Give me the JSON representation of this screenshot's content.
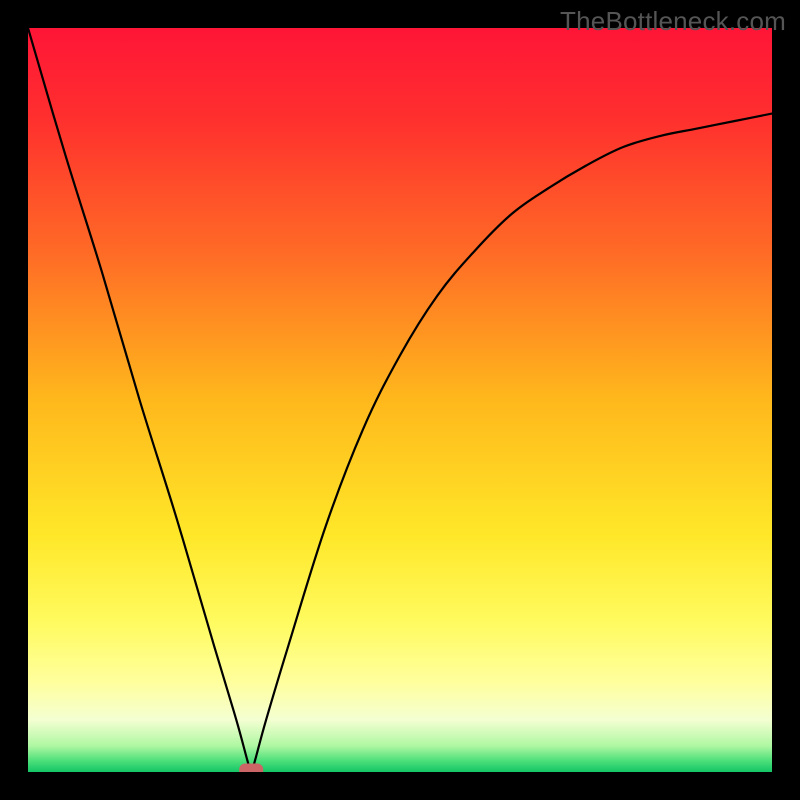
{
  "watermark": "TheBottleneck.com",
  "chart_data": {
    "type": "line",
    "title": "",
    "xlabel": "",
    "ylabel": "",
    "xlim": [
      0,
      1
    ],
    "ylim": [
      0,
      1
    ],
    "minimum_x": 0.3,
    "marker": {
      "x": 0.3,
      "y": 0.0,
      "color": "#cc6666"
    },
    "series": [
      {
        "name": "curve",
        "x": [
          0.0,
          0.05,
          0.1,
          0.15,
          0.2,
          0.25,
          0.28,
          0.295,
          0.3,
          0.305,
          0.32,
          0.35,
          0.4,
          0.45,
          0.5,
          0.55,
          0.6,
          0.65,
          0.7,
          0.75,
          0.8,
          0.85,
          0.9,
          0.95,
          1.0
        ],
        "values": [
          1.0,
          0.83,
          0.67,
          0.5,
          0.34,
          0.17,
          0.07,
          0.015,
          0.0,
          0.015,
          0.07,
          0.17,
          0.33,
          0.46,
          0.56,
          0.64,
          0.7,
          0.75,
          0.785,
          0.815,
          0.84,
          0.855,
          0.865,
          0.875,
          0.885
        ]
      }
    ],
    "gradient_stops": [
      {
        "offset": 0.0,
        "color": "#ff1537"
      },
      {
        "offset": 0.12,
        "color": "#ff2f2e"
      },
      {
        "offset": 0.3,
        "color": "#ff6a26"
      },
      {
        "offset": 0.5,
        "color": "#ffb81c"
      },
      {
        "offset": 0.68,
        "color": "#ffe728"
      },
      {
        "offset": 0.8,
        "color": "#fffb60"
      },
      {
        "offset": 0.88,
        "color": "#ffff9e"
      },
      {
        "offset": 0.93,
        "color": "#f4ffd2"
      },
      {
        "offset": 0.965,
        "color": "#aef7a2"
      },
      {
        "offset": 0.985,
        "color": "#4cdf7a"
      },
      {
        "offset": 1.0,
        "color": "#15c566"
      }
    ]
  }
}
